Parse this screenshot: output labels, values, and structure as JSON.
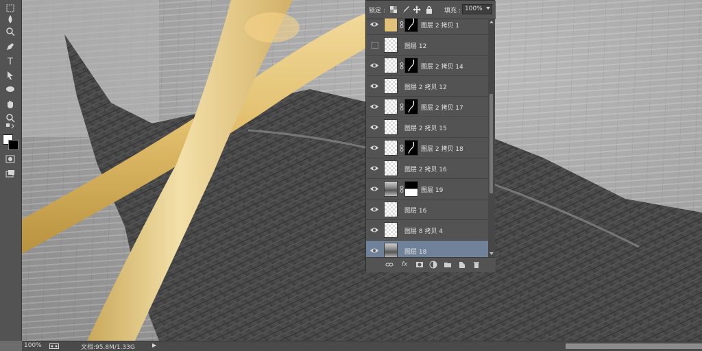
{
  "layers_panel": {
    "lock_label": "锁定 :",
    "fill_label": "填充 :",
    "fill_value": "100%",
    "layers": [
      {
        "name": "图层 2 拷贝 1",
        "visible": true,
        "thumb": "gold",
        "has_mask": true
      },
      {
        "name": "图层 12",
        "visible": false,
        "thumb": "blank",
        "has_mask": false
      },
      {
        "name": "图层 2 拷贝 14",
        "visible": true,
        "thumb": "blank",
        "has_mask": true
      },
      {
        "name": "图层 2 拷贝 12",
        "visible": true,
        "thumb": "blank",
        "has_mask": false
      },
      {
        "name": "图层 2 拷贝 17",
        "visible": true,
        "thumb": "blank",
        "has_mask": true
      },
      {
        "name": "图层 2 拷贝 15",
        "visible": true,
        "thumb": "blank",
        "has_mask": false
      },
      {
        "name": "图层 2 拷贝 18",
        "visible": true,
        "thumb": "blank",
        "has_mask": true
      },
      {
        "name": "图层 2 拷贝 16",
        "visible": true,
        "thumb": "blank",
        "has_mask": false
      },
      {
        "name": "图层 19",
        "visible": true,
        "thumb": "texture",
        "has_mask": true
      },
      {
        "name": "图层 16",
        "visible": true,
        "thumb": "blank",
        "has_mask": false
      },
      {
        "name": "图层 8 拷贝 4",
        "visible": true,
        "thumb": "blank",
        "has_mask": false
      },
      {
        "name": "图层 18",
        "visible": true,
        "thumb": "texture",
        "has_mask": false,
        "selected": true
      }
    ],
    "footer_icons": [
      "link-icon",
      "fx-icon",
      "add-mask-icon",
      "adjustment-icon",
      "folder-icon",
      "new-layer-icon",
      "trash-icon"
    ]
  },
  "status_bar": {
    "zoom": "100%",
    "doc_info": "文档:95.8M/1.33G",
    "arrow": "▶"
  },
  "toolbar": {
    "tools": [
      "rectangle-select-icon",
      "drop-icon",
      "zoom-icon",
      "pen-icon",
      "type-icon",
      "path-select-icon",
      "ellipse-icon",
      "hand-icon",
      "magnify-icon",
      "swap-colors-icon",
      "quick-mask-icon",
      "screen-mode-icon"
    ],
    "type_glyph": "T",
    "fx_glyph": "fx",
    "foreground_color": "#ffffff",
    "background_color": "#000000"
  },
  "colors": {
    "panel": "#535353",
    "selected_row": "#6f8299",
    "stick": "#e2c27a",
    "stroke": "#4a4a4a"
  }
}
